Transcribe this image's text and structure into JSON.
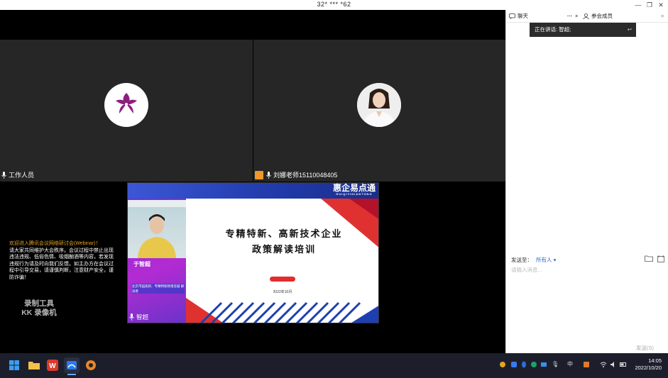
{
  "window": {
    "title": "32* *** *62"
  },
  "tiles": {
    "staff": {
      "name": "工作人员"
    },
    "teacher": {
      "name": "刘娜老师15110048405"
    }
  },
  "notice": {
    "line1": "欢迎进入腾讯会议网络研讨会(Webinar)！",
    "body": "请大家共同维护大会秩序。会议过程中禁止出现违法违规、低俗色情、吸烟酗酒等内容，若发现违规行为请及时向我们反馈。如主办方在会议过程中引导交易，请谨慎判断，注意财产安全，谨防诈骗！"
  },
  "watermark": {
    "line1": "录制工具",
    "line2": "KK 录像机"
  },
  "share": {
    "brand": "惠企易点通",
    "brand_sub": "HUIQIYIDIANTONG",
    "slide_title_1": "专精特新、高新技术企业",
    "slide_title_2": "政策解读培训",
    "date": "2022年10月",
    "speaker": "于智超",
    "org": "北京市国高新、专精特新政策答疑 解读者",
    "presenter_tag": "智超"
  },
  "chat": {
    "tab_chat": "聊天",
    "tab_more": "···",
    "tab_close": "×",
    "tab_members": "参会成员",
    "speaking": "正在讲话: 智超;",
    "send_to_label": "发送至：",
    "send_to_value": "所有人",
    "input_placeholder": "请输入消息...",
    "send_button": "发送(S)"
  },
  "taskbar": {
    "time": "14:05",
    "date": "2022/10/20",
    "ime": "中"
  },
  "colors": {
    "accent": "#2a6bd8",
    "notice_highlight": "#e8a31d",
    "share_purple": "#b32bd2"
  }
}
